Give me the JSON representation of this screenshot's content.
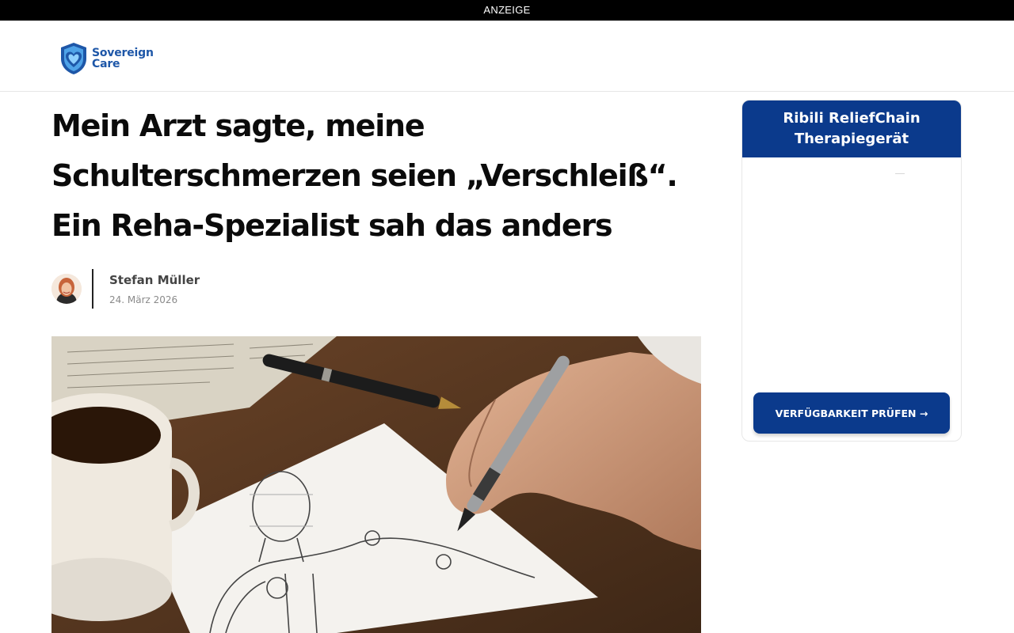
{
  "ad_banner": {
    "label": "ANZEIGE"
  },
  "header": {
    "logo": {
      "line1": "Sovereign",
      "line2": "Care",
      "icon": "heart-shield-icon",
      "color": "#1e57a8"
    }
  },
  "article": {
    "headline_lines": [
      "Mein Arzt sagte, meine",
      "Schulterschmerzen seien „Verschleiß“.",
      "Ein Reha-Spezialist sah das anders"
    ],
    "author": {
      "name": "Stefan Müller",
      "date": "24. März 2026"
    }
  },
  "sidebar": {
    "title": "Ribili ReliefChain Therapiegerät",
    "cta_label": "VERFÜGBARKEIT PRÜFEN →",
    "accent_color": "#0b3a8c"
  }
}
